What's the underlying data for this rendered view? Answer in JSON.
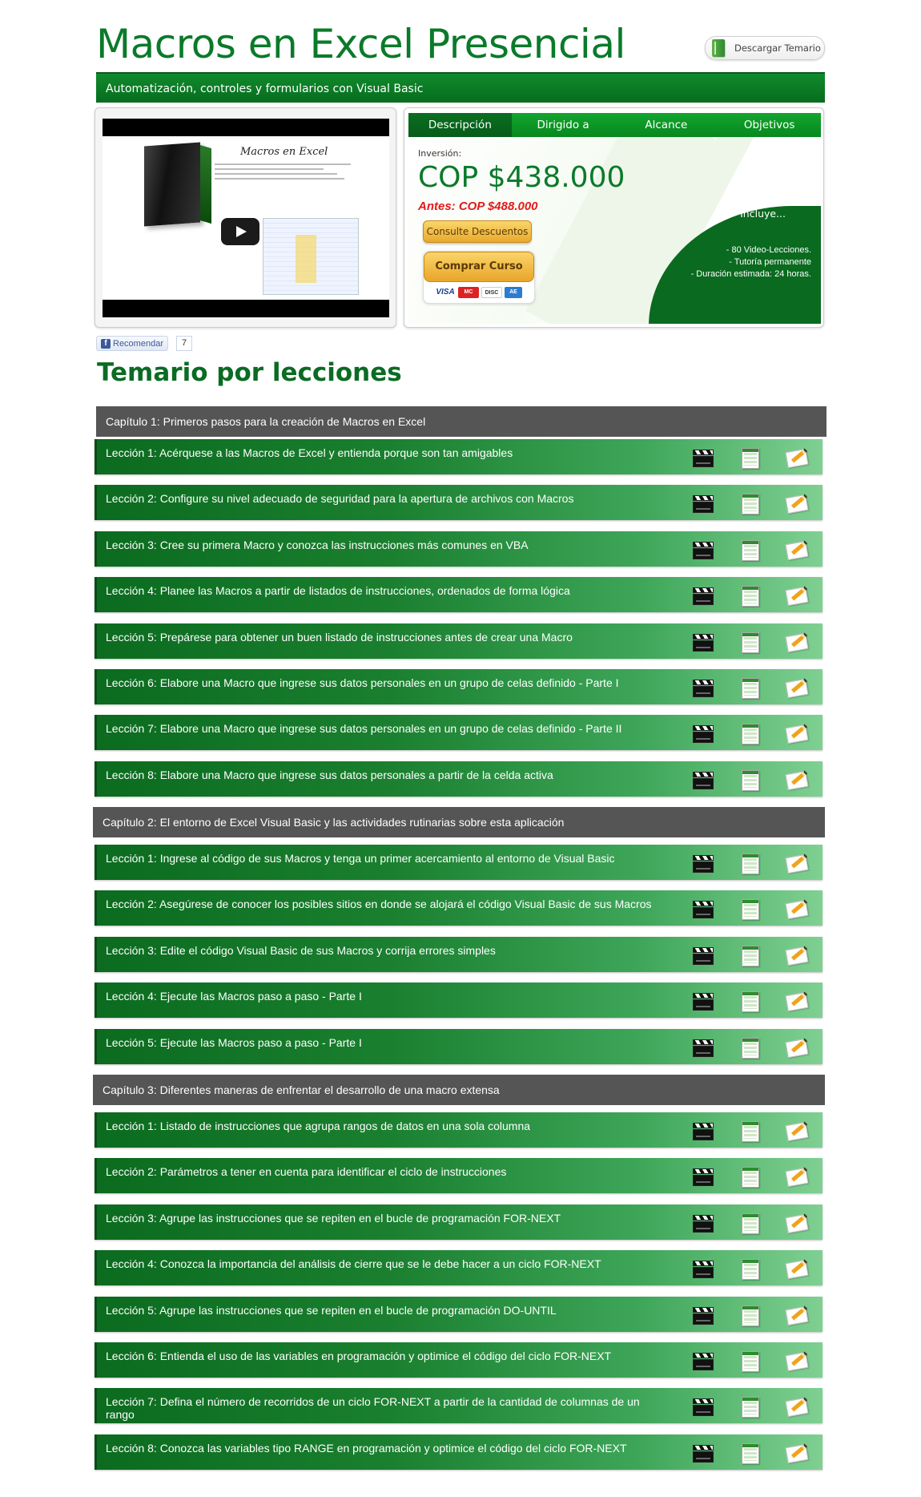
{
  "header": {
    "title": "Macros en Excel Presencial",
    "download_label": "Descargar Temario",
    "subtitle": "Automatización, controles y formularios con Visual Basic"
  },
  "video": {
    "heading": "Macros en Excel"
  },
  "pricing": {
    "tabs": [
      "Descripción",
      "Dirigido a",
      "Alcance",
      "Objetivos"
    ],
    "active_tab": "Descripción",
    "investment_label": "Inversión:",
    "price": "COP $438.000",
    "old_price": "Antes: COP $488.000",
    "discount_button": "Consulte Descuentos",
    "buy_button": "Comprar Curso",
    "cards": [
      "VISA",
      "MasterCard",
      "DISCOVER",
      "AMEX"
    ],
    "includes_title": "Incluye...",
    "includes": [
      "- 80 Video-Lecciones.",
      "- Tutoría permanente",
      "- Duración estimada: 24 horas."
    ]
  },
  "social": {
    "recommend_label": "Recomendar",
    "count": "7"
  },
  "syllabus": {
    "title": "Temario por lecciones",
    "chapters": [
      {
        "title": "Capítulo 1: Primeros pasos para la creación de Macros en Excel",
        "lessons": [
          "Lección 1: Acérquese a las Macros de Excel y entienda porque son tan amigables",
          "Lección 2: Configure su nivel adecuado de seguridad para la apertura de archivos con Macros",
          "Lección 3: Cree su primera Macro y conozca las instrucciones más comunes en VBA",
          "Lección 4: Planee las Macros a partir de listados de instrucciones, ordenados de forma lógica",
          "Lección 5: Prepárese para obtener un buen listado de instrucciones antes de crear una Macro",
          "Lección 6: Elabore una Macro que ingrese sus datos personales en un grupo de celas definido - Parte I",
          "Lección 7: Elabore una Macro que ingrese sus datos personales en un grupo de celas definido - Parte II",
          "Lección 8: Elabore una Macro que ingrese sus datos personales a partir de la celda activa"
        ]
      },
      {
        "title": "Capítulo 2: El entorno de Excel Visual Basic y las actividades rutinarias sobre esta aplicación",
        "lessons": [
          "Lección 1: Ingrese al código de sus Macros y tenga un primer acercamiento al entorno de Visual Basic",
          "Lección 2: Asegúrese de conocer los posibles sitios en donde se alojará el código Visual Basic de sus Macros",
          "Lección 3: Edite el código Visual Basic de sus Macros y corrija errores simples",
          "Lección 4: Ejecute las Macros paso a paso - Parte I",
          "Lección 5: Ejecute las Macros paso a paso - Parte I"
        ]
      },
      {
        "title": "Capítulo 3: Diferentes maneras de enfrentar el desarrollo de una macro extensa",
        "lessons": [
          "Lección 1: Listado de instrucciones que agrupa rangos de datos en una sola columna",
          "Lección 2: Parámetros a tener en cuenta para identificar el ciclo de instrucciones",
          "Lección 3: Agrupe las instrucciones que se repiten en el bucle de programación FOR-NEXT",
          "Lección 4: Conozca la importancia del análisis de cierre que se le debe hacer a un ciclo FOR-NEXT",
          "Lección 5: Agrupe las instrucciones que se repiten en el bucle de programación DO-UNTIL",
          "Lección 6: Entienda el uso de las variables en programación y optimice el código del ciclo FOR-NEXT",
          "Lección 7: Defina el número de recorridos de un ciclo FOR-NEXT a partir de la cantidad de columnas de un rango",
          "Lección 8: Conozca las variables tipo RANGE en programación y optimice el código del ciclo FOR-NEXT"
        ]
      }
    ]
  }
}
